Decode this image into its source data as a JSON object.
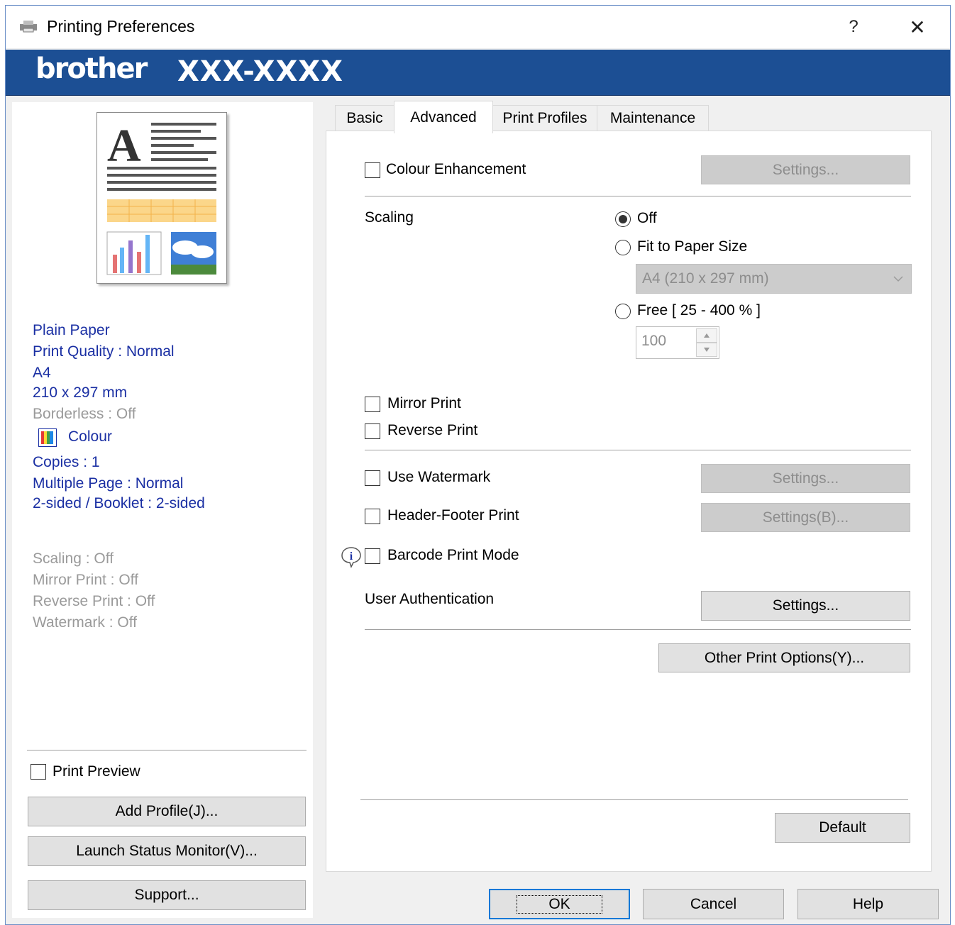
{
  "window": {
    "title": "Printing Preferences",
    "help_glyph": "?",
    "close_glyph": "✕"
  },
  "banner": {
    "brand": "brother",
    "model": "XXX-XXXX"
  },
  "summary": {
    "media": "Plain Paper",
    "quality": "Print Quality : Normal",
    "paper": "A4",
    "dimensions": "210 x 297 mm",
    "borderless": "Borderless : Off",
    "colour": "Colour",
    "copies": "Copies : 1",
    "multiple_page": "Multiple Page : Normal",
    "two_sided": "2-sided / Booklet : 2-sided",
    "scaling": "Scaling : Off",
    "mirror": "Mirror Print : Off",
    "reverse": "Reverse Print : Off",
    "watermark": "Watermark : Off"
  },
  "left_controls": {
    "print_preview": "Print Preview",
    "add_profile": "Add Profile(J)...",
    "status_monitor": "Launch Status Monitor(V)...",
    "support": "Support..."
  },
  "tabs": [
    "Basic",
    "Advanced",
    "Print Profiles",
    "Maintenance"
  ],
  "active_tab": "Advanced",
  "advanced": {
    "colour_enhancement": "Colour Enhancement",
    "settings": "Settings...",
    "scaling_label": "Scaling",
    "scaling_options": [
      "Off",
      "Fit to Paper Size",
      "Free [ 25 - 400 % ]"
    ],
    "scaling_selected": "Off",
    "paper_size": "A4 (210 x 297 mm)",
    "free_value": "100",
    "mirror_print": "Mirror Print",
    "reverse_print": "Reverse Print",
    "use_watermark": "Use Watermark",
    "header_footer": "Header-Footer Print",
    "settings_b": "Settings(B)...",
    "barcode_mode": "Barcode Print Mode",
    "user_auth": "User Authentication",
    "other_options": "Other Print Options(Y)...",
    "default": "Default"
  },
  "footer": {
    "ok": "OK",
    "cancel": "Cancel",
    "help": "Help"
  },
  "colors": {
    "banner": "#1c4f94",
    "summary_text": "#1a2fa3",
    "disabled_text": "#9a9a9a"
  }
}
